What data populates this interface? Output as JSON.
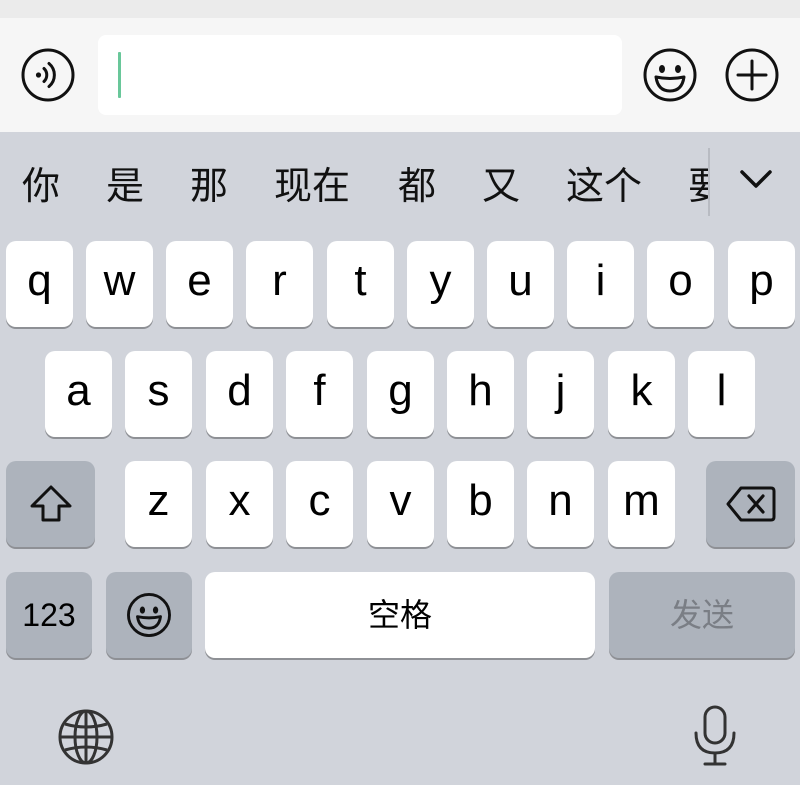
{
  "input_bar": {
    "voice_icon": "voice-wave-icon",
    "text_value": "",
    "emoji_icon": "smiley-face-icon",
    "plus_icon": "plus-circle-icon"
  },
  "candidates": [
    "你",
    "是",
    "那",
    "现在",
    "都",
    "又",
    "这个",
    "要"
  ],
  "expand_icon": "chevron-down-icon",
  "keyboard": {
    "row1": [
      "q",
      "w",
      "e",
      "r",
      "t",
      "y",
      "u",
      "i",
      "o",
      "p"
    ],
    "row2": [
      "a",
      "s",
      "d",
      "f",
      "g",
      "h",
      "j",
      "k",
      "l"
    ],
    "row3": [
      "z",
      "x",
      "c",
      "v",
      "b",
      "n",
      "m"
    ],
    "shift_icon": "shift-arrow-icon",
    "delete_icon": "backspace-icon",
    "numbers_label": "123",
    "emoji_key_icon": "smiley-face-icon",
    "space_label": "空格",
    "send_label": "发送",
    "globe_icon": "globe-icon",
    "mic_icon": "microphone-icon"
  },
  "colors": {
    "keyboard_bg": "#d1d4db",
    "key": "#ffffff",
    "function_key": "#adb3bc",
    "caret": "#69c79a",
    "send_text_disabled": "#7a7e85"
  }
}
